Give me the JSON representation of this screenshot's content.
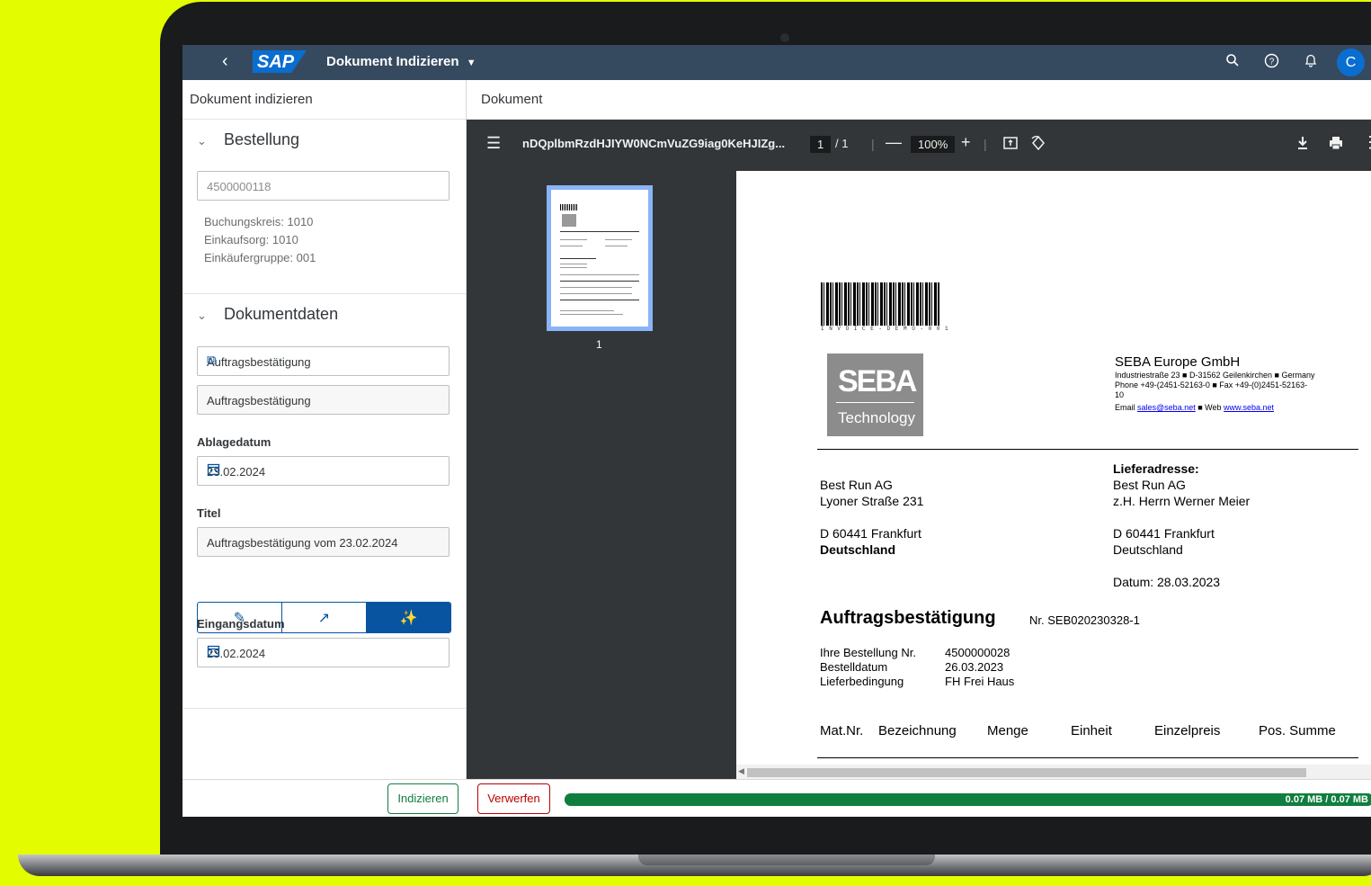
{
  "shell": {
    "title": "Dokument Indizieren",
    "dropdown_icon": "chevron-down-icon",
    "avatar_initial": "C",
    "logo": "SAP",
    "icons": [
      "search-icon",
      "help-icon",
      "bell-icon"
    ]
  },
  "left": {
    "header": "Dokument indizieren",
    "bestellung": {
      "title": "Bestellung",
      "placeholder": "4500000118",
      "meta": [
        "Buchungskreis: 1010",
        "Einkaufsorg: 1010",
        "Einkäufergruppe: 001"
      ]
    },
    "dokumentdaten": {
      "title": "Dokumentdaten",
      "doctype_value": "Auftragsbestätigung",
      "doctype_readonly": "Auftragsbestätigung",
      "ablagedatum_label": "Ablagedatum",
      "ablagedatum_value": "23.02.2024",
      "titel_label": "Titel",
      "titel_value": "Auftragsbestätigung vom 23.02.2024",
      "eingangsdatum_label": "Eingangsdatum",
      "eingangsdatum_value": "23.02.2024"
    }
  },
  "footer": {
    "index_button": "Indizieren",
    "discard_button": "Verwerfen",
    "progress_label": "0.07 MB / 0.07 MB",
    "progress_fraction": 1.0
  },
  "document": {
    "header": "Dokument",
    "file_name": "nDQplbmRzdHJIYW0NCmVuZG9iag0KeHJIZg...",
    "page_current": "1",
    "page_total": "/ 1",
    "zoom": "100%",
    "thumb_number": "1"
  },
  "pdf": {
    "barcode_text": "I N V O I C E - D E M O - 0 0 1",
    "logo_top": "SEBA",
    "logo_bottom": "Technology",
    "company": "SEBA Europe GmbH",
    "address_line": "Industriestraße 23 ■ D-31562 Geilenkirchen ■ Germany",
    "phone_line": "Phone +49-(2451-52163-0 ■ Fax +49-(0)2451-52163-",
    "phone_line2": "10",
    "email_label": "Email",
    "email": "sales@seba.net",
    "web_label": "■ Web",
    "web": "www.seba.net",
    "recipient": [
      "Best Run AG",
      "Lyoner Straße 231"
    ],
    "recipient_city": "D 60441 Frankfurt",
    "recipient_country": "Deutschland",
    "delivery_title": "Lieferadresse:",
    "delivery": [
      "Best Run AG",
      "z.H. Herrn Werner Meier"
    ],
    "delivery_city": "D 60441 Frankfurt",
    "delivery_country": "Deutschland",
    "date": "Datum: 28.03.2023",
    "doc_title": "Auftragsbestätigung",
    "doc_number": "Nr. SEB020230328-1",
    "info_labels": [
      "Ihre Bestellung Nr.",
      "Bestelldatum",
      "Lieferbedingung"
    ],
    "info_values": [
      "4500000028",
      "26.03.2023",
      "FH Frei Haus"
    ],
    "table_headers": [
      "Mat.Nr.",
      "Bezeichnung",
      "Menge",
      "Einheit",
      "Einzelpreis",
      "Pos. Summe"
    ]
  },
  "colors": {
    "shell": "#354a5f",
    "accent": "#0854a0",
    "success": "#107e3e",
    "negative": "#bb0000",
    "viewer": "#323639"
  }
}
